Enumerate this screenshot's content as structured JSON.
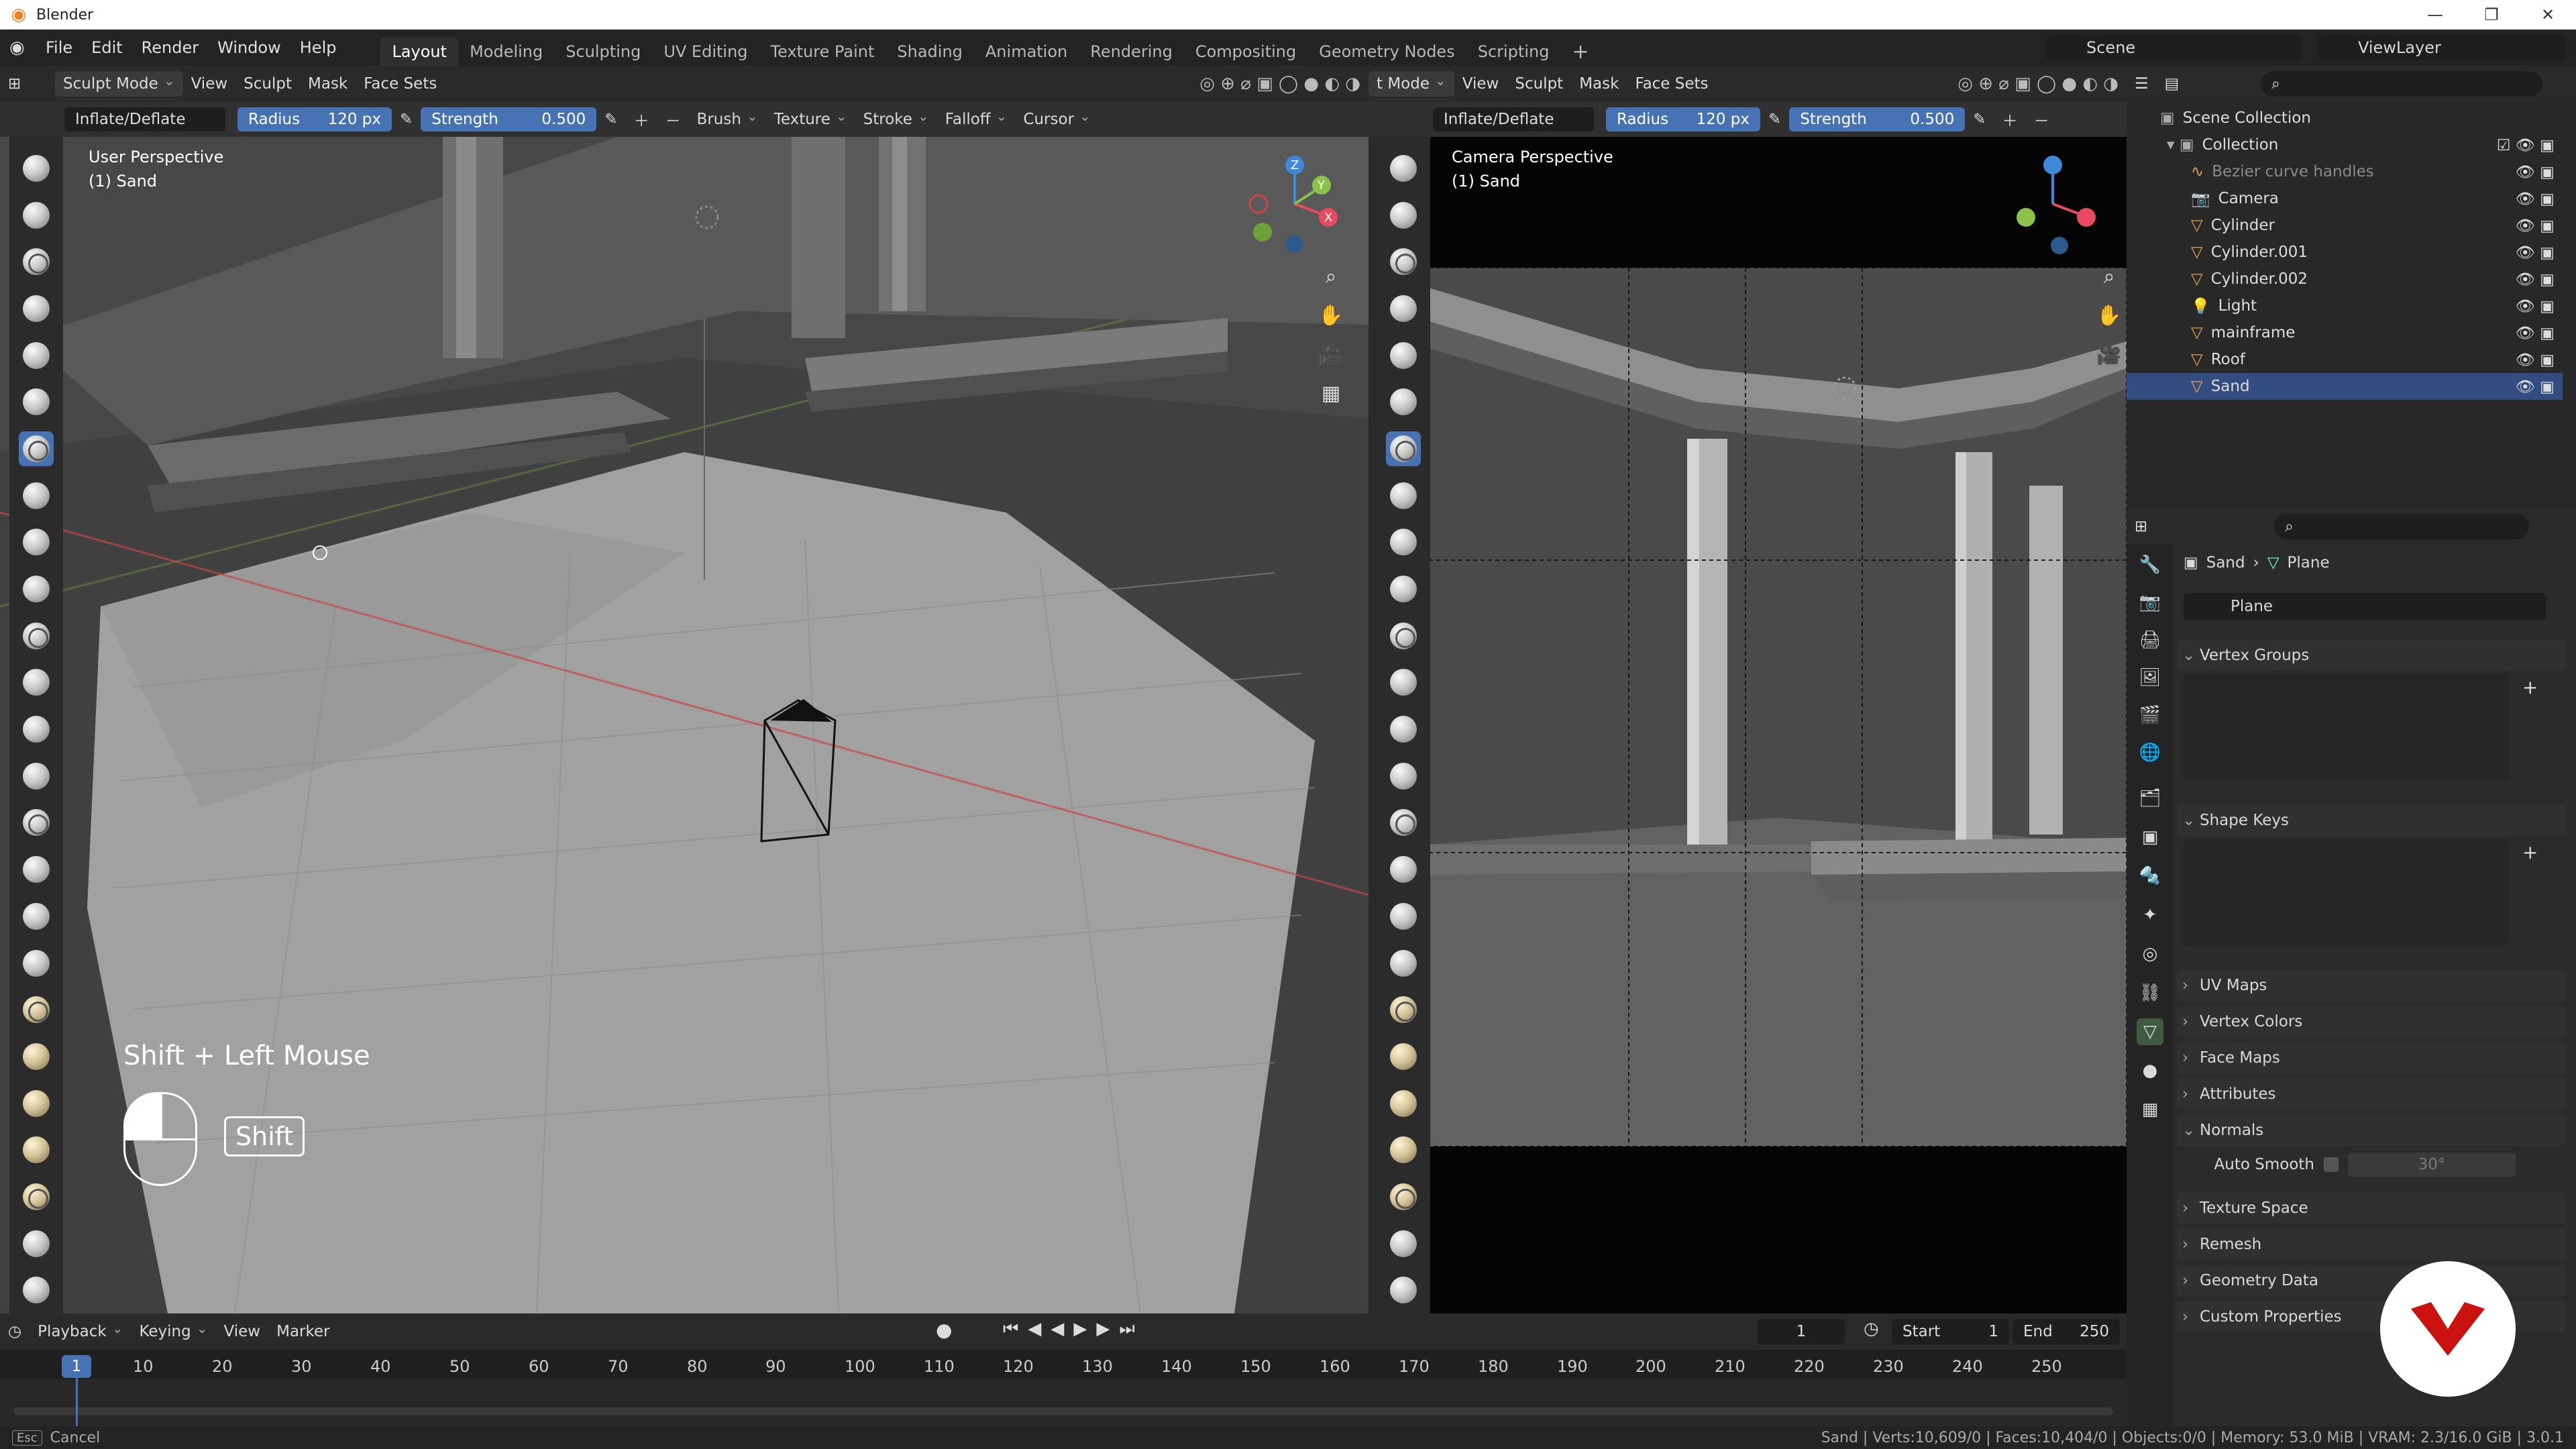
{
  "window": {
    "title": "Blender",
    "controls": [
      "—",
      "❐",
      "✕"
    ]
  },
  "menu": [
    "File",
    "Edit",
    "Render",
    "Window",
    "Help"
  ],
  "workspaces": [
    "Layout",
    "Modeling",
    "Sculpting",
    "UV Editing",
    "Texture Paint",
    "Shading",
    "Animation",
    "Rendering",
    "Compositing",
    "Geometry Nodes",
    "Scripting"
  ],
  "active_workspace": "Layout",
  "scene": {
    "label": "Scene",
    "viewlayer": "ViewLayer"
  },
  "left_vp": {
    "mode": "Sculpt Mode",
    "menus": [
      "View",
      "Sculpt",
      "Mask",
      "Face Sets"
    ],
    "brush_name": "Inflate/Deflate",
    "radius_label": "Radius",
    "radius_value": "120 px",
    "strength_label": "Strength",
    "strength_value": "0.500",
    "tool_menus": [
      "Brush",
      "Texture",
      "Stroke",
      "Falloff",
      "Cursor"
    ],
    "perspective": "User Perspective",
    "object": "(1) Sand",
    "key_hint": "Shift + Left Mouse",
    "key_name": "Shift"
  },
  "right_vp": {
    "mode": "t Mode",
    "menus": [
      "View",
      "Sculpt",
      "Mask",
      "Face Sets"
    ],
    "brush_name": "Inflate/Deflate",
    "radius_label": "Radius",
    "radius_value": "120 px",
    "strength_label": "Strength",
    "strength_value": "0.500",
    "perspective": "Camera Perspective",
    "object": "(1) Sand"
  },
  "gizmo": {
    "x": "X",
    "y": "Y",
    "z": "Z"
  },
  "outliner": {
    "root": "Scene Collection",
    "collection": "Collection",
    "items": [
      {
        "name": "Bezier curve handles",
        "icon": "curve-icon",
        "dim": true
      },
      {
        "name": "Camera",
        "icon": "camera-icon"
      },
      {
        "name": "Cylinder",
        "icon": "mesh-icon"
      },
      {
        "name": "Cylinder.001",
        "icon": "mesh-icon"
      },
      {
        "name": "Cylinder.002",
        "icon": "mesh-icon"
      },
      {
        "name": "Light",
        "icon": "light-icon"
      },
      {
        "name": "mainframe",
        "icon": "mesh-icon"
      },
      {
        "name": "Roof",
        "icon": "mesh-icon"
      },
      {
        "name": "Sand",
        "icon": "mesh-icon",
        "selected": true
      }
    ]
  },
  "properties": {
    "breadcrumb_object": "Sand",
    "breadcrumb_data": "Plane",
    "mesh_name": "Plane",
    "panels": [
      {
        "label": "Vertex Groups",
        "open": true
      },
      {
        "label": "Shape Keys",
        "open": true
      },
      {
        "label": "UV Maps",
        "open": false
      },
      {
        "label": "Vertex Colors",
        "open": false
      },
      {
        "label": "Face Maps",
        "open": false
      },
      {
        "label": "Attributes",
        "open": false
      },
      {
        "label": "Normals",
        "open": true
      },
      {
        "label": "Texture Space",
        "open": false
      },
      {
        "label": "Remesh",
        "open": false
      },
      {
        "label": "Geometry Data",
        "open": false
      },
      {
        "label": "Custom Properties",
        "open": false
      }
    ],
    "auto_smooth_label": "Auto Smooth",
    "auto_smooth_angle": "30°"
  },
  "timeline": {
    "menus": [
      "Playback",
      "Keying",
      "View",
      "Marker"
    ],
    "current_frame": "1",
    "start_label": "Start",
    "start": "1",
    "end_label": "End",
    "end": "250",
    "ticks": [
      "1",
      "10",
      "20",
      "30",
      "40",
      "50",
      "60",
      "70",
      "80",
      "90",
      "100",
      "110",
      "120",
      "130",
      "140",
      "150",
      "160",
      "170",
      "180",
      "190",
      "200",
      "210",
      "220",
      "230",
      "240",
      "250"
    ]
  },
  "status": {
    "left": "Cancel",
    "right": "Sand | Verts:10,609/0 | Faces:10,404/0 | Objects:0/0 | Memory: 53.0 MiB | VRAM: 2.3/16.0 GiB | 3.0.1"
  },
  "colors": {
    "accent": "#4772b3",
    "x_axis": "#e84a5f",
    "y_axis": "#8bc34a",
    "z_axis": "#3f88d8",
    "record_badge": "#cc1111"
  }
}
